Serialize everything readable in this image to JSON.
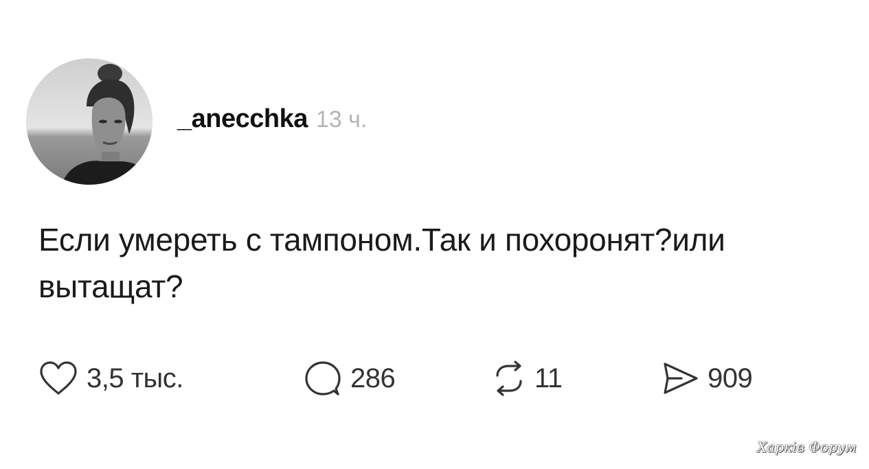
{
  "post": {
    "username": "_anecchka",
    "timestamp": "13 ч.",
    "text": "Если умереть с тампоном.Так и похоронят?или вытащат?",
    "avatar_icon": "user-avatar-photo"
  },
  "actions": {
    "likes": {
      "icon": "heart-icon",
      "count": "3,5 тыс."
    },
    "comments": {
      "icon": "comment-bubble-icon",
      "count": "286"
    },
    "reposts": {
      "icon": "repost-icon",
      "count": "11"
    },
    "shares": {
      "icon": "send-icon",
      "count": "909"
    }
  },
  "watermark": "Харків Форум",
  "colors": {
    "text": "#1a1a1a",
    "muted": "#b4b4b4",
    "icon": "#333333",
    "background": "#ffffff"
  }
}
